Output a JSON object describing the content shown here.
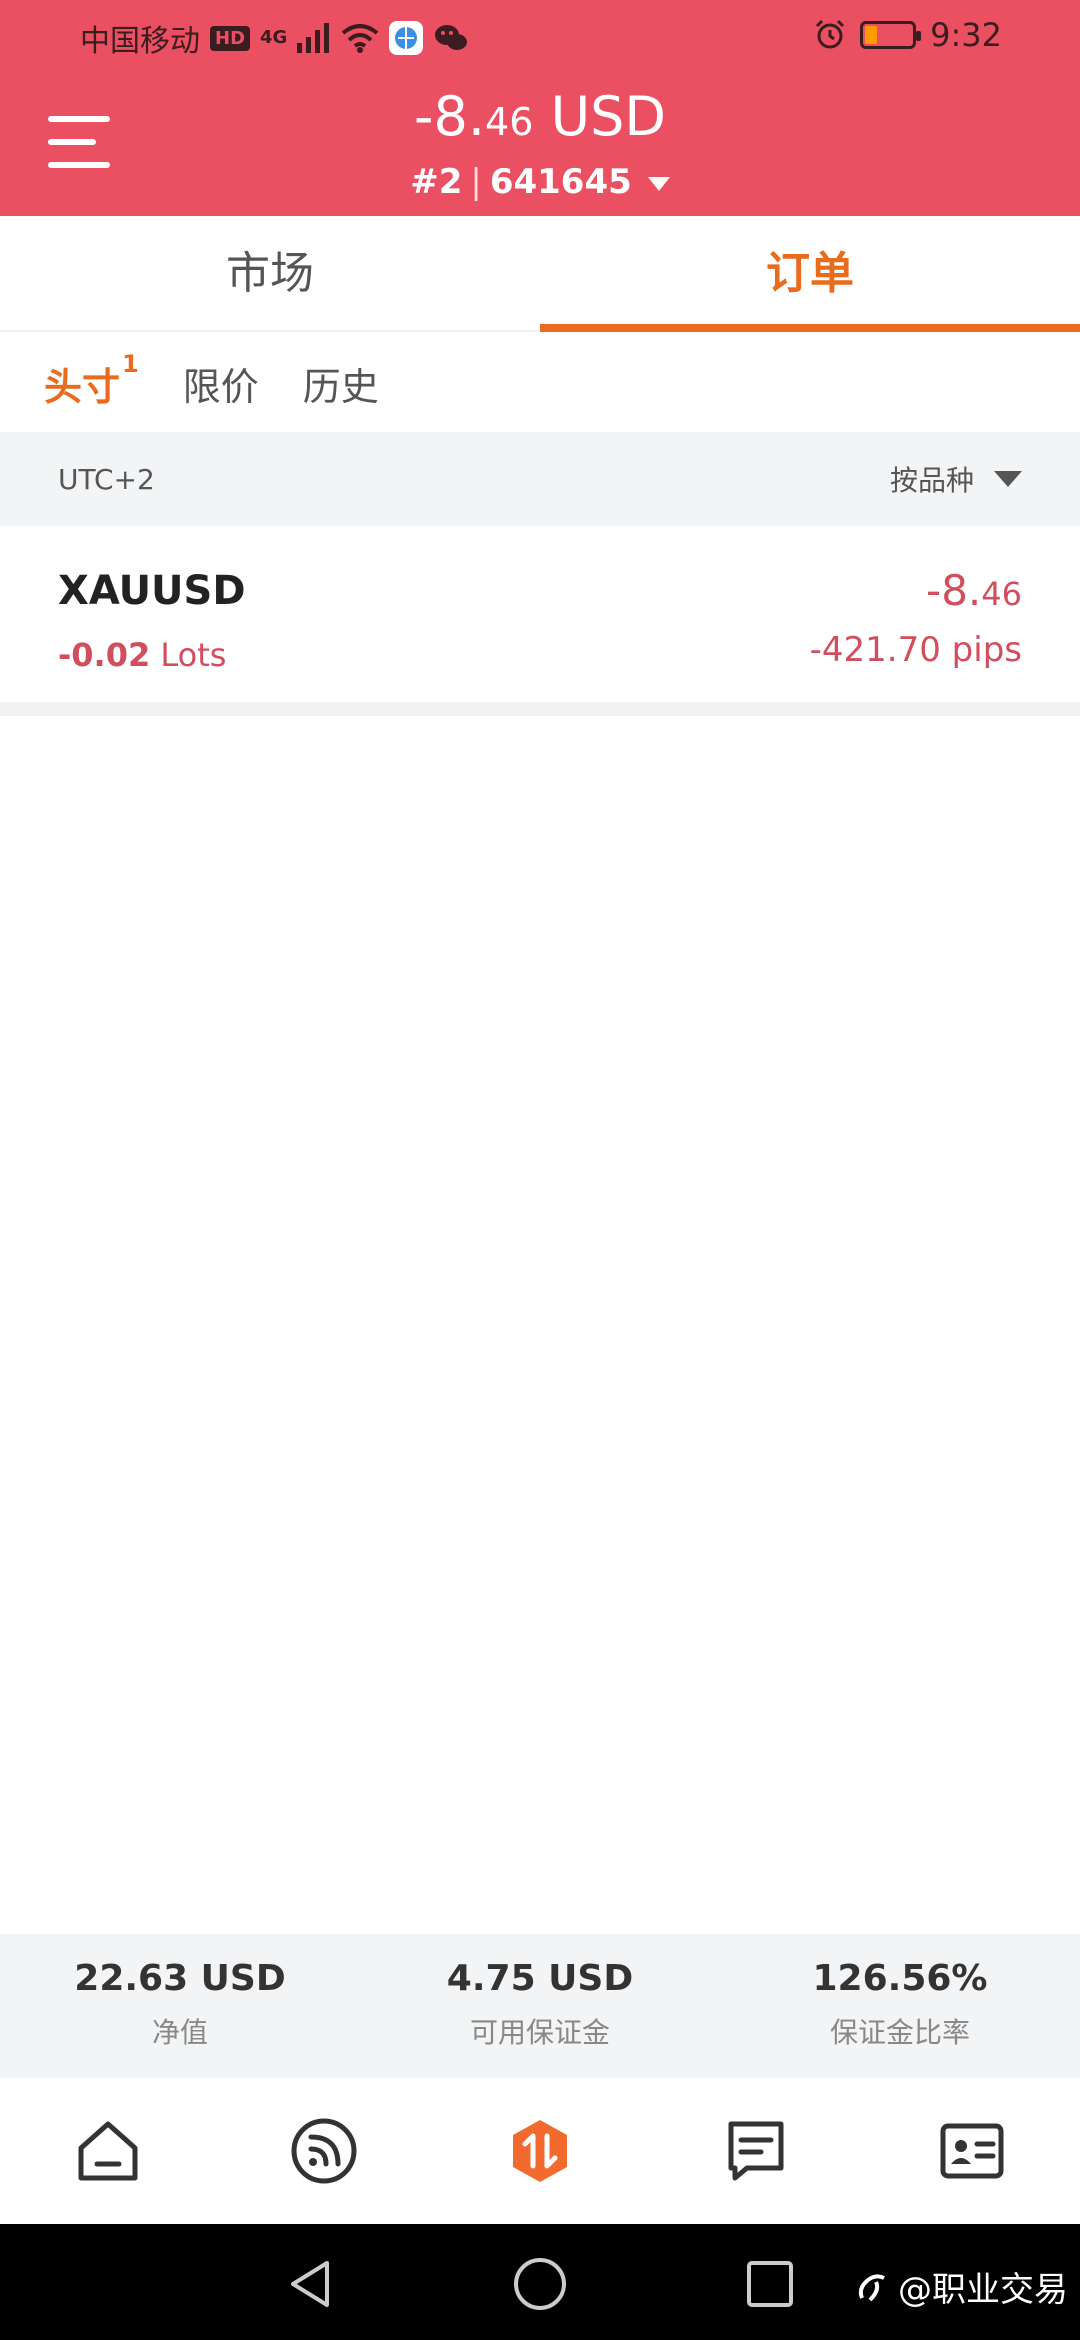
{
  "statusbar": {
    "carrier": "中国移动",
    "hd_badge": "HD",
    "network": "4G",
    "time": "9:32"
  },
  "header": {
    "balance_int": "-8.",
    "balance_dec": "46",
    "currency": "USD",
    "account_num": "#2",
    "account_sep": "|",
    "account_id": "641645"
  },
  "tabs": [
    {
      "label": "市场",
      "active": false
    },
    {
      "label": "订单",
      "active": true
    }
  ],
  "subtabs": [
    {
      "label": "头寸",
      "count": "1",
      "active": true
    },
    {
      "label": "限价",
      "active": false
    },
    {
      "label": "历史",
      "active": false
    }
  ],
  "filter": {
    "timezone": "UTC+2",
    "group_by": "按品种"
  },
  "position": {
    "symbol": "XAUUSD",
    "lots_value": "-0.02",
    "lots_unit": "Lots",
    "pnl_int": "-8.",
    "pnl_dec": "46",
    "pips": "-421.70 pips"
  },
  "summary": [
    {
      "value": "22.63 USD",
      "label": "净值"
    },
    {
      "value": "4.75 USD",
      "label": "可用保证金"
    },
    {
      "value": "126.56%",
      "label": "保证金比率"
    }
  ],
  "bottomnav": [
    {
      "icon": "home-icon"
    },
    {
      "icon": "feed-icon"
    },
    {
      "icon": "trade-icon",
      "active": true
    },
    {
      "icon": "message-icon"
    },
    {
      "icon": "profile-card-icon"
    }
  ],
  "watermark": "@职业交易",
  "colors": {
    "header_bg": "#ea5061",
    "accent": "#e96b1e",
    "negative": "#d14e5e"
  }
}
